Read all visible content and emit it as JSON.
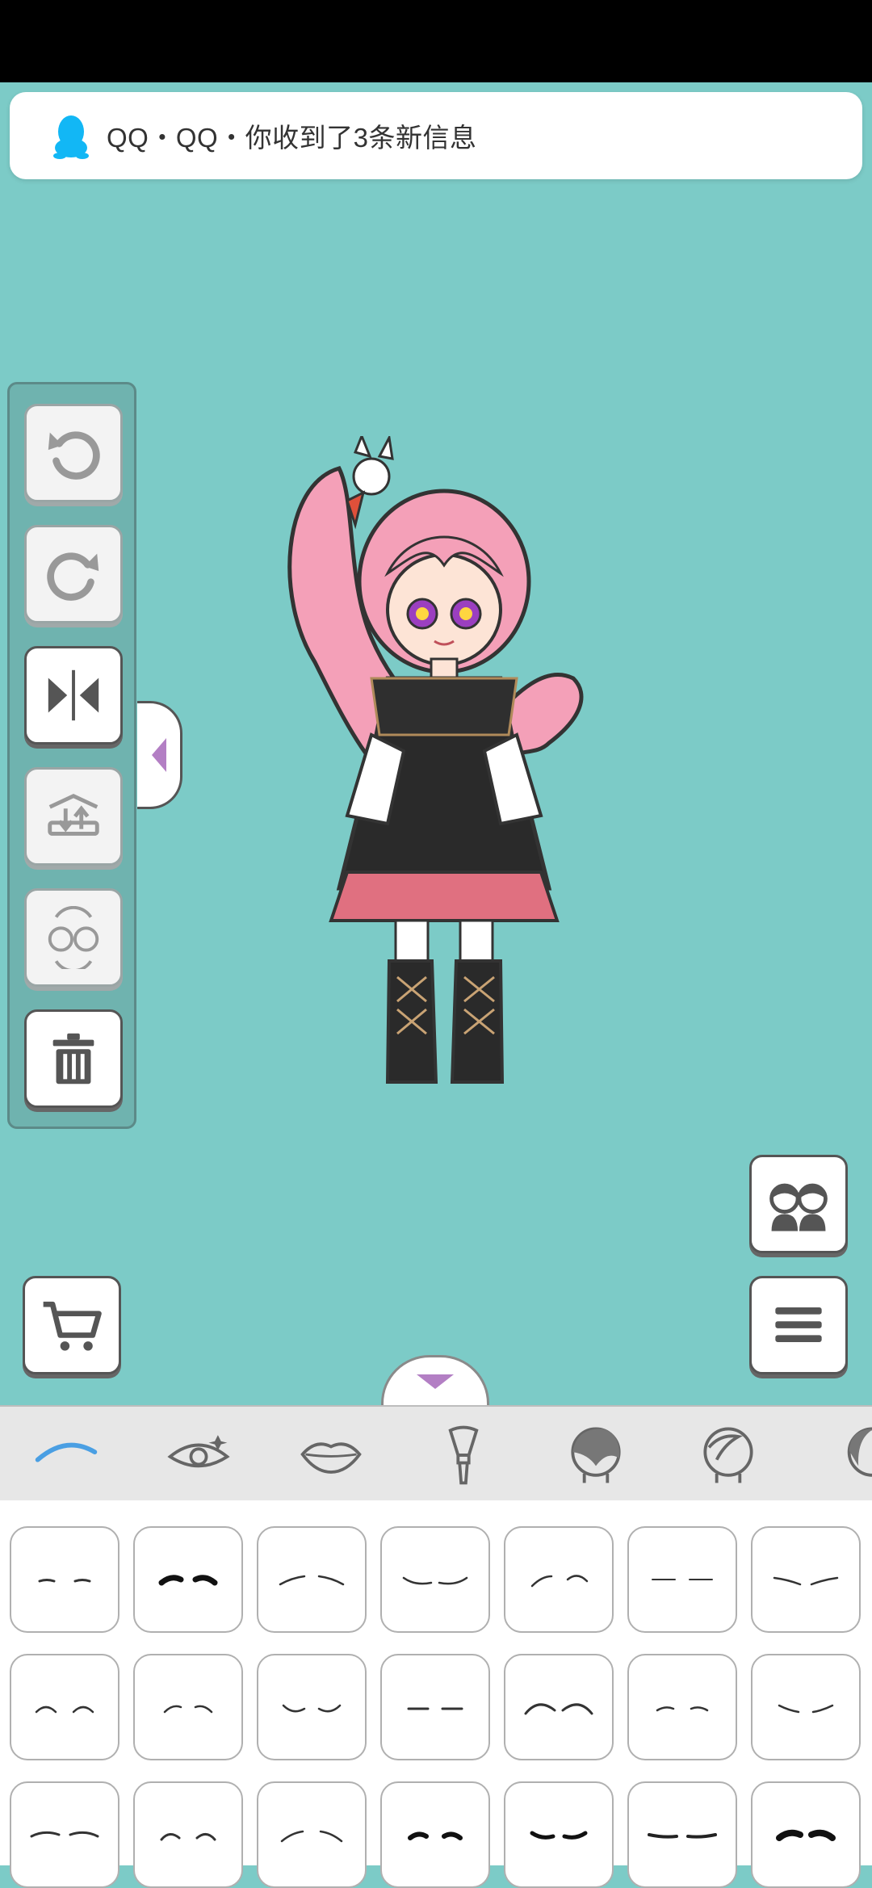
{
  "notification": {
    "app_name": "QQ",
    "message": "QQ・QQ・你收到了3条新信息",
    "icon": "qq-penguin-icon"
  },
  "toolbar": {
    "undo": "undo-icon",
    "redo": "redo-icon",
    "flip": "flip-horizontal-icon",
    "layer": "layer-swap-icon",
    "swap_character": "swap-character-icon",
    "delete": "trash-icon"
  },
  "side_tab": "collapse-left-icon",
  "buttons": {
    "characters": "two-characters-icon",
    "cart": "cart-icon",
    "menu": "hamburger-menu-icon"
  },
  "category_tabs": [
    {
      "name": "eyebrows",
      "active": true
    },
    {
      "name": "eyes",
      "active": false
    },
    {
      "name": "lips",
      "active": false
    },
    {
      "name": "makeup",
      "active": false
    },
    {
      "name": "hair-front",
      "active": false
    },
    {
      "name": "hair-back",
      "active": false
    },
    {
      "name": "hair-side",
      "active": false
    }
  ],
  "colors": {
    "background": "#7ccbc7",
    "accent": "#4a9fe3",
    "panel": "#6fb3af"
  },
  "eyebrow_options_count_visible": 21
}
